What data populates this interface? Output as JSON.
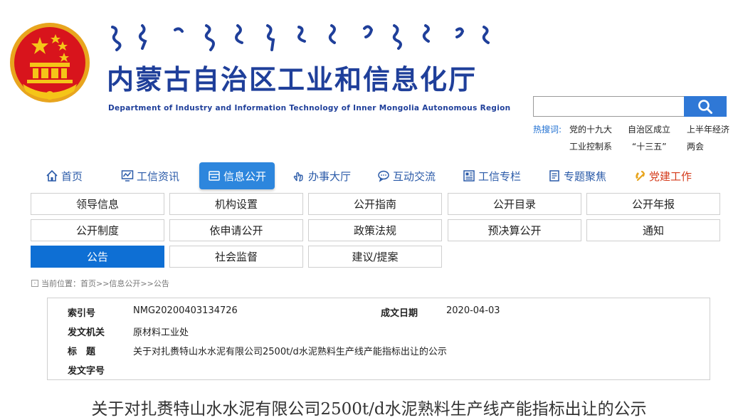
{
  "header": {
    "title": "内蒙古自治区工业和信息化厅",
    "subtitle": "Department of Industry and Information Technology of Inner Mongolia Autonomous Region"
  },
  "search": {
    "value": "",
    "placeholder": "",
    "hot_label": "热搜词:",
    "hot_words": [
      "党的十九大",
      "自治区成立",
      "上半年经济",
      "工业控制系",
      "“十三五”",
      "两会"
    ]
  },
  "nav": [
    {
      "label": "首页",
      "icon": "home-icon"
    },
    {
      "label": "工信资讯",
      "icon": "chart-monitor-icon"
    },
    {
      "label": "信息公开",
      "icon": "screen-icon",
      "active": true
    },
    {
      "label": "办事大厅",
      "icon": "hand-pointer-icon"
    },
    {
      "label": "互动交流",
      "icon": "chat-bubble-icon"
    },
    {
      "label": "工信专栏",
      "icon": "newspaper-icon"
    },
    {
      "label": "专题聚焦",
      "icon": "document-icon"
    },
    {
      "label": "党建工作",
      "icon": "party-emblem-icon",
      "color": "#d43a1a"
    }
  ],
  "subnav": [
    "领导信息",
    "机构设置",
    "公开指南",
    "公开目录",
    "公开年报",
    "公开制度",
    "依申请公开",
    "政策法规",
    "预决算公开",
    "通知",
    "公告",
    "社会监督",
    "建议/提案"
  ],
  "subnav_active": "公告",
  "breadcrumb": "当前位置：首页>>信息公开>>公告",
  "meta": {
    "index_label": "索引号",
    "index_value": "NMG20200403134726",
    "date_label": "成文日期",
    "date_value": "2020-04-03",
    "issuer_label": "发文机关",
    "issuer_value": "原材料工业处",
    "title_label": "标　题",
    "title_value": "关于对扎赉特山水水泥有限公司2500t/d水泥熟料生产线产能指标出让的公示",
    "docno_label": "发文字号",
    "docno_value": ""
  },
  "article": {
    "title": "关于对扎赉特山水水泥有限公司2500t/d水泥熟料生产线产能指标出让的公示"
  },
  "colors": {
    "brand_blue": "#1f3f9a",
    "active_blue": "#0e6fd4",
    "nav_blue": "#2a5aa8",
    "party_red": "#d43a1a"
  }
}
